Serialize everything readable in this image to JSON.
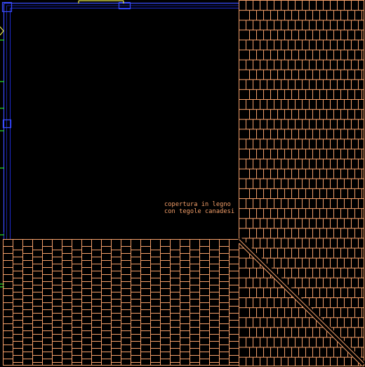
{
  "drawing": {
    "background": "#000000",
    "roof_color": "#f5a06a",
    "wall_color": "#1e2ccf",
    "wall_color_light": "#3a4cff",
    "accent_green": "#28e028",
    "accent_yellow": "#e8e84a"
  },
  "annotation": {
    "line1": "copertura in legno",
    "line2": "con tegole canadesi"
  }
}
